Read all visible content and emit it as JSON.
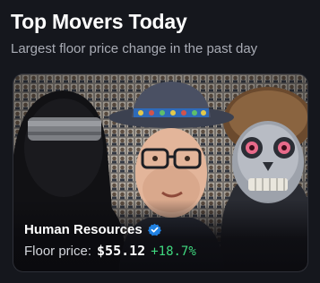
{
  "widget": {
    "title": "Top Movers Today",
    "subtitle": "Largest floor price change in the past day"
  },
  "card": {
    "collection_name": "Human Resources",
    "verified_icon": "verified-badge-icon",
    "floor_price_label": "Floor price:",
    "floor_price_value": "$55.12",
    "price_change": "+18.7%",
    "colors": {
      "change_positive": "#3fd87f",
      "verified": "#2081e2",
      "background": "#15171d"
    }
  }
}
